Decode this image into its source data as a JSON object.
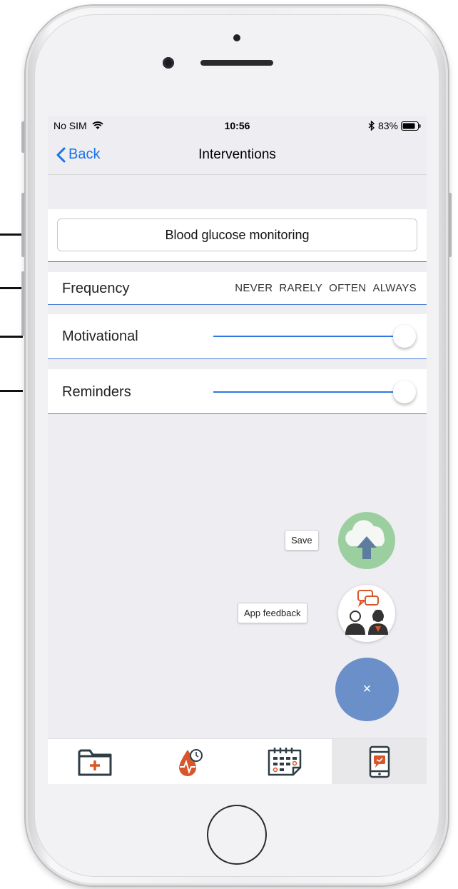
{
  "status": {
    "carrier": "No SIM",
    "time": "10:56",
    "battery": "83%"
  },
  "nav": {
    "back": "Back",
    "title": "Interventions"
  },
  "intervention": {
    "name": "Blood glucose monitoring"
  },
  "frequency": {
    "label": "Frequency",
    "options": [
      "NEVER",
      "RARELY",
      "OFTEN",
      "ALWAYS"
    ]
  },
  "rows": [
    {
      "label": "Motivational",
      "slider_value": 1.0
    },
    {
      "label": "Reminders",
      "slider_value": 1.0
    }
  ],
  "fab": {
    "save_label": "Save",
    "feedback_label": "App feedback",
    "close_symbol": "×"
  },
  "tabs": [
    {
      "icon": "medical-folder-icon"
    },
    {
      "icon": "blood-drop-clock-icon"
    },
    {
      "icon": "calendar-icon"
    },
    {
      "icon": "phone-feedback-icon",
      "active": true
    }
  ],
  "colors": {
    "accent": "#1a73e8",
    "fab_blue": "#6a8fc9",
    "save_green": "#9ccf9f",
    "icon_orange": "#d8572a"
  }
}
